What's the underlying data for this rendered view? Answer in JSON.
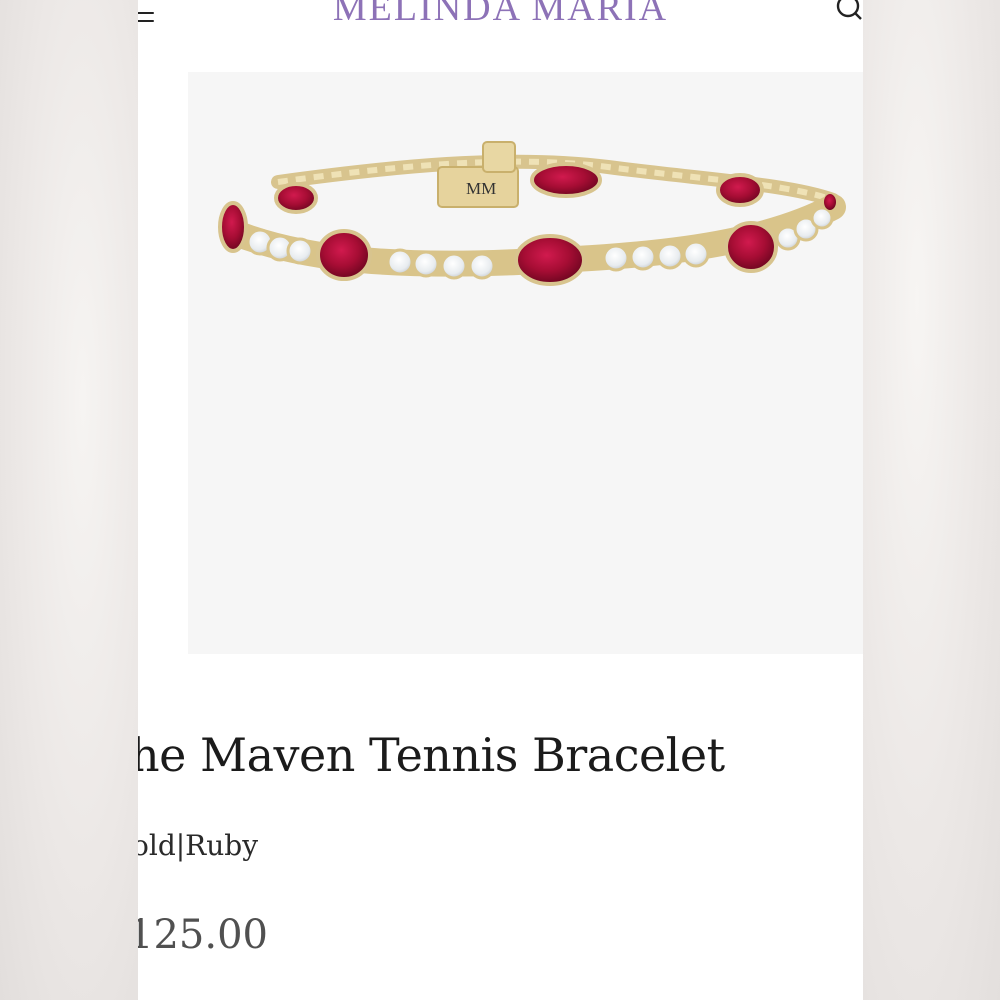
{
  "header": {
    "brand": "MELINDA MARIA",
    "brand_color": "#8d72b7",
    "menu_icon": "hamburger-menu-icon",
    "search_icon": "search-icon"
  },
  "product": {
    "image_alt": "bracelet-product-image",
    "clasp_engraving": "MM",
    "title": "he Maven Tennis Bracelet",
    "variant": "old|Ruby",
    "price": "125.00"
  }
}
